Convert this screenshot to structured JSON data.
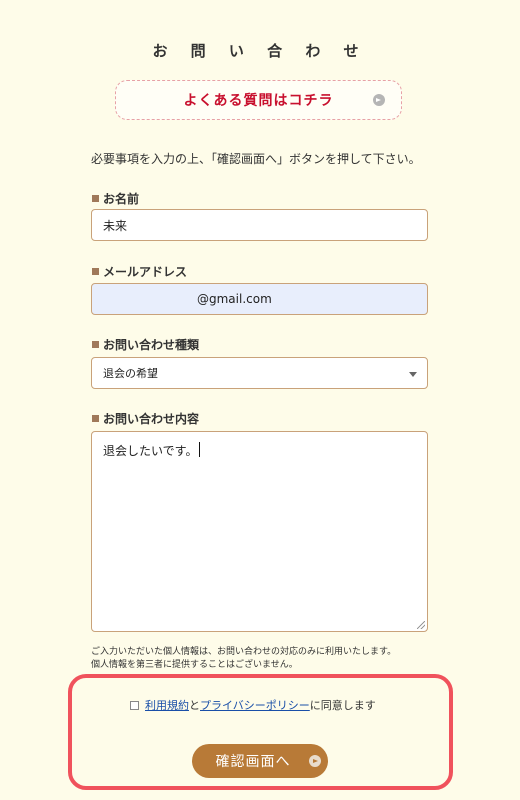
{
  "page": {
    "title": "お 問 い 合 わ せ",
    "faq_link": "よくある質問はコチラ",
    "intro": "必要事項を入力の上、「確認画面へ」ボタンを押して下さい。"
  },
  "form": {
    "name": {
      "label": "お名前",
      "value": "未来"
    },
    "email": {
      "label": "メールアドレス",
      "value": "@gmail.com"
    },
    "category": {
      "label": "お問い合わせ種類",
      "selected": "退会の希望"
    },
    "content": {
      "label": "お問い合わせ内容",
      "value": "退会したいです。"
    }
  },
  "privacy_note": {
    "line1": "ご入力いただいた個人情報は、お問い合わせの対応のみに利用いたします。",
    "line2": "個人情報を第三者に提供することはございません。"
  },
  "agreement": {
    "terms_link": "利用規約",
    "and": "と",
    "privacy_link": "プライバシーポリシー",
    "suffix": "に同意します",
    "checked": false
  },
  "submit_label": "確認画面へ",
  "colors": {
    "background": "#fefce9",
    "accent_brown": "#b87a37",
    "faq_red": "#c8102e",
    "highlight_red": "#f0525c",
    "link_blue": "#1a4fa8"
  }
}
